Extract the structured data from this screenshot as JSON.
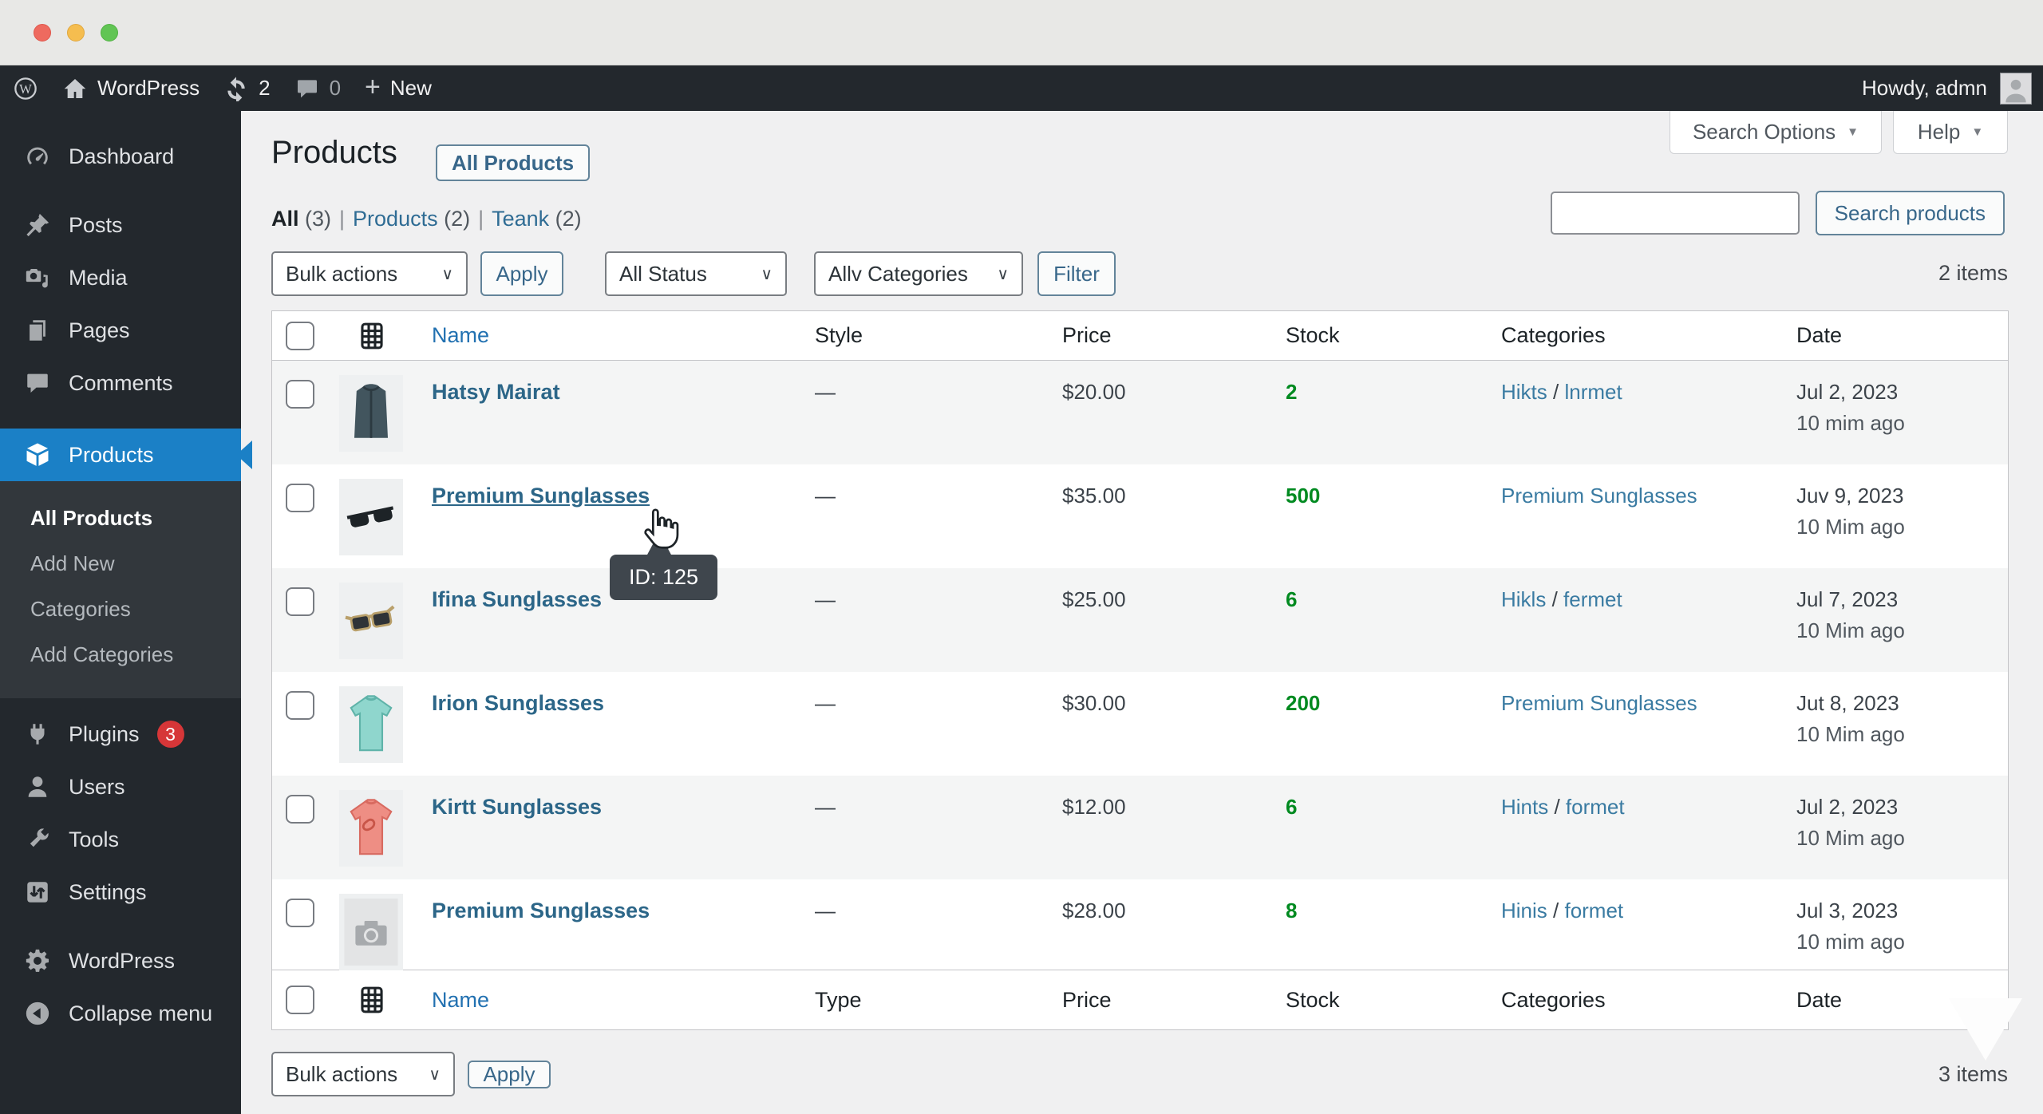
{
  "window": {
    "style": "macos"
  },
  "admin_bar": {
    "site_name": "WordPress",
    "updates_count": "2",
    "comments_count": "0",
    "new_label": "New",
    "howdy": "Howdy, admn"
  },
  "sidebar": {
    "items": [
      {
        "label": "Dashboard",
        "icon": "dashboard-icon"
      },
      {
        "label": "Posts",
        "icon": "pin-icon",
        "gap_before": true
      },
      {
        "label": "Media",
        "icon": "media-icon"
      },
      {
        "label": "Pages",
        "icon": "pages-icon"
      },
      {
        "label": "Comments",
        "icon": "comments-icon"
      },
      {
        "label": "Products",
        "icon": "products-box-icon",
        "active": true,
        "gap_before": true,
        "submenu": [
          {
            "label": "All Products",
            "current": true
          },
          {
            "label": "Add New"
          },
          {
            "label": "Categories"
          },
          {
            "label": "Add Categories"
          }
        ]
      },
      {
        "label": "Plugins",
        "icon": "plugins-icon",
        "badge": "3"
      },
      {
        "label": "Users",
        "icon": "users-icon"
      },
      {
        "label": "Tools",
        "icon": "tools-icon"
      },
      {
        "label": "Settings",
        "icon": "settings-icon"
      },
      {
        "label": "WordPress",
        "icon": "gear-icon",
        "gap_before": true
      },
      {
        "label": "Collapse menu",
        "icon": "collapse-icon"
      }
    ]
  },
  "meta_tabs": {
    "search_options": "Search Options",
    "help": "Help"
  },
  "page": {
    "title": "Products",
    "title_action": "All Products"
  },
  "filters": {
    "links": [
      {
        "label": "All",
        "count": "(3)",
        "current": true
      },
      {
        "label": "Products",
        "count": "(2)"
      },
      {
        "label": "Teank",
        "count": "(2)"
      }
    ]
  },
  "toolbar": {
    "bulk_actions": "Bulk actions",
    "apply": "Apply",
    "all_status": "All Status",
    "all_categories": "Allv Categories",
    "filter": "Filter",
    "search_placeholder": "",
    "search_button": "Search products",
    "items_top": "2 items",
    "items_bottom": "3 items"
  },
  "table": {
    "header_top": [
      "Name",
      "Style",
      "Price",
      "Stock",
      "Categories",
      "Date"
    ],
    "header_bottom": [
      "Name",
      "Type",
      "Price",
      "Stock",
      "Categories",
      "Date"
    ],
    "rows": [
      {
        "name": "Hatsy Mairat",
        "thumb": "jacket",
        "style": "—",
        "price": "$20.00",
        "stock": "2",
        "categories": [
          "Hikts",
          "lnrmet"
        ],
        "date_line1": "Jul 2, 2023",
        "date_line2": "10 mim ago"
      },
      {
        "name": "Premium Sunglasses",
        "thumb": "sunglasses-dark",
        "style": "—",
        "price": "$35.00",
        "stock": "500",
        "categories": [
          "Premium Sunglasses"
        ],
        "date_line1": "Juv 9, 2023",
        "date_line2": "10 Mim ago",
        "hovered": true
      },
      {
        "name": "Ifina Sunglasses",
        "thumb": "sunglasses-tan",
        "style": "—",
        "price": "$25.00",
        "stock": "6",
        "categories": [
          "Hikls",
          "fermet"
        ],
        "date_line1": "Jul 7, 2023",
        "date_line2": "10 Mim ago"
      },
      {
        "name": "Irion Sunglasses",
        "thumb": "tshirt-teal",
        "style": "—",
        "price": "$30.00",
        "stock": "200",
        "categories": [
          "Premium Sunglasses"
        ],
        "date_line1": "Jut 8, 2023",
        "date_line2": "10 Mim ago"
      },
      {
        "name": "Kirtt Sunglasses",
        "thumb": "tshirt-red",
        "style": "—",
        "price": "$12.00",
        "stock": "6",
        "categories": [
          "Hints",
          "formet"
        ],
        "date_line1": "Jul 2, 2023",
        "date_line2": "10 Mim ago"
      },
      {
        "name": "Premium Sunglasses",
        "thumb": "placeholder",
        "style": "—",
        "price": "$28.00",
        "stock": "8",
        "categories": [
          "Hinis",
          "formet"
        ],
        "date_line1": "Jul 3, 2023",
        "date_line2": "10 mim ago"
      }
    ]
  },
  "tooltip": {
    "text": "ID: 125"
  },
  "colors": {
    "accent_blue": "#1b80c6",
    "link_blue": "#2271b1",
    "stock_green": "#008a20",
    "badge_red": "#d63638",
    "adminbar_bg": "#23282d",
    "content_bg": "#f0f0f1"
  }
}
